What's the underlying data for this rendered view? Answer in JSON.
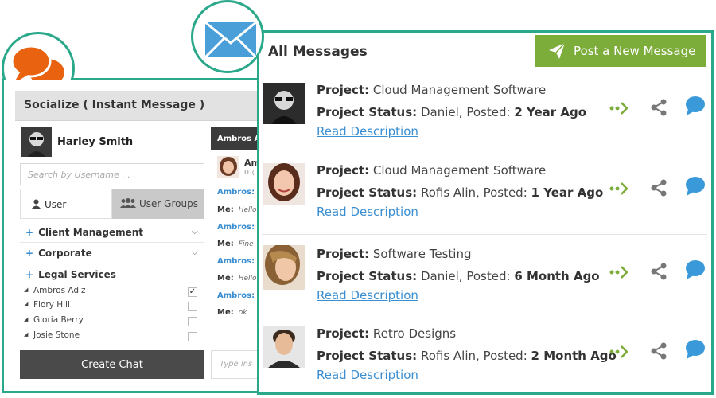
{
  "socialize": {
    "header": "Socialize ( Instant Message )",
    "current_user": "Harley Smith",
    "search_placeholder": "Search by Username . . .",
    "tabs": [
      {
        "label": "User"
      },
      {
        "label": "User Groups"
      }
    ],
    "categories": [
      {
        "label": "Client Management"
      },
      {
        "label": "Corporate"
      },
      {
        "label": "Legal Services"
      }
    ],
    "members": [
      {
        "name": "Ambros Adiz",
        "checked": true
      },
      {
        "name": "Flory Hill",
        "checked": false
      },
      {
        "name": "Gloria Berry",
        "checked": false
      },
      {
        "name": "Josie Stone",
        "checked": false
      }
    ],
    "create_chat_label": "Create Chat"
  },
  "chat": {
    "tab_label": "Ambros Ad",
    "contact_name": "Am",
    "contact_sub": "IT (",
    "lines": [
      {
        "from": "Ambros:",
        "text": ""
      },
      {
        "from": "Me:",
        "text": "Hello"
      },
      {
        "from": "Ambros:",
        "text": ""
      },
      {
        "from": "Me:",
        "text": "Fine"
      },
      {
        "from": "Ambros:",
        "text": ""
      },
      {
        "from": "Me:",
        "text": "Hello"
      },
      {
        "from": "Ambros:",
        "text": ""
      },
      {
        "from": "Me:",
        "text": "ok"
      }
    ],
    "input_placeholder": "Type ins"
  },
  "messages": {
    "title": "All Messages",
    "post_button": "Post a New Message",
    "project_label": "Project:",
    "status_label": "Project Status:",
    "posted_label": "Posted:",
    "link_label": "Read Description",
    "items": [
      {
        "project": "Cloud Management Software",
        "person": "Daniel,",
        "posted": "2 Year Ago"
      },
      {
        "project": "Cloud Management Software",
        "person": "Rofis Alin,",
        "posted": "1 Year Ago"
      },
      {
        "project": "Software Testing",
        "person": "Daniel,",
        "posted": "6 Month Ago"
      },
      {
        "project": "Retro Designs",
        "person": "Rofis Alin,",
        "posted": "2 Month Ago"
      }
    ]
  },
  "colors": {
    "accent_teal": "#2aa88a",
    "post_green": "#7cac3a",
    "link_blue": "#3a8ed1",
    "chat_orange": "#e8620f",
    "mail_blue": "#4a9fd8"
  },
  "icons": [
    "chat-bubbles-icon",
    "mail-icon",
    "paper-plane-icon",
    "forward-arrow-icon",
    "share-icon",
    "comment-icon",
    "user-icon",
    "users-icon",
    "chevron-down-icon"
  ]
}
